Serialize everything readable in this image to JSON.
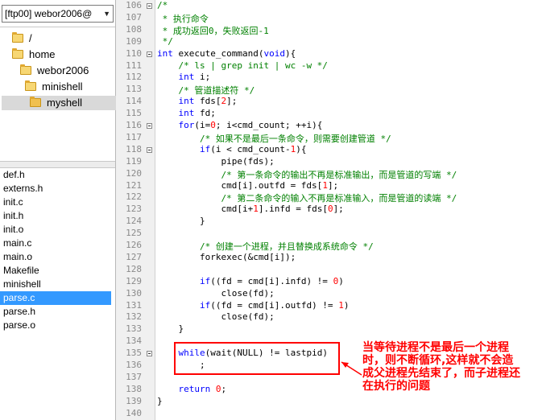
{
  "ftp_selector": {
    "value": "[ftp00] webor2006@"
  },
  "tree": [
    {
      "label": "/"
    },
    {
      "label": "home"
    },
    {
      "label": "webor2006"
    },
    {
      "label": "minishell"
    },
    {
      "label": "myshell",
      "selected": true
    }
  ],
  "files": [
    {
      "name": "def.h"
    },
    {
      "name": "externs.h"
    },
    {
      "name": "init.c"
    },
    {
      "name": "init.h"
    },
    {
      "name": "init.o"
    },
    {
      "name": "main.c"
    },
    {
      "name": "main.o"
    },
    {
      "name": "Makefile"
    },
    {
      "name": "minishell"
    },
    {
      "name": "parse.c",
      "selected": true
    },
    {
      "name": "parse.h"
    },
    {
      "name": "parse.o"
    }
  ],
  "code_lines": [
    {
      "n": "106",
      "fold": true,
      "segs": [
        [
          "c",
          "/*"
        ]
      ]
    },
    {
      "n": "107",
      "segs": [
        [
          "c",
          " * 执行命令"
        ]
      ]
    },
    {
      "n": "108",
      "segs": [
        [
          "c",
          " * 成功返回0，失败返回-1"
        ]
      ]
    },
    {
      "n": "109",
      "segs": [
        [
          "c",
          " */"
        ]
      ]
    },
    {
      "n": "110",
      "fold": true,
      "segs": [
        [
          "k",
          "int"
        ],
        [
          "p",
          " execute_command("
        ],
        [
          "k",
          "void"
        ],
        [
          "p",
          "){"
        ]
      ]
    },
    {
      "n": "111",
      "segs": [
        [
          "p",
          "    "
        ],
        [
          "c",
          "/* ls | grep init | wc -w */"
        ]
      ]
    },
    {
      "n": "112",
      "segs": [
        [
          "p",
          "    "
        ],
        [
          "k",
          "int"
        ],
        [
          "p",
          " i;"
        ]
      ]
    },
    {
      "n": "113",
      "segs": [
        [
          "p",
          "    "
        ],
        [
          "c",
          "/* 管道描述符 */"
        ]
      ]
    },
    {
      "n": "114",
      "segs": [
        [
          "p",
          "    "
        ],
        [
          "k",
          "int"
        ],
        [
          "p",
          " fds["
        ],
        [
          "n",
          "2"
        ],
        [
          "p",
          "];"
        ]
      ]
    },
    {
      "n": "115",
      "segs": [
        [
          "p",
          "    "
        ],
        [
          "k",
          "int"
        ],
        [
          "p",
          " fd;"
        ]
      ]
    },
    {
      "n": "116",
      "fold": true,
      "segs": [
        [
          "p",
          "    "
        ],
        [
          "k",
          "for"
        ],
        [
          "p",
          "(i="
        ],
        [
          "n",
          "0"
        ],
        [
          "p",
          "; i<cmd_count; ++i){"
        ]
      ]
    },
    {
      "n": "117",
      "segs": [
        [
          "p",
          "        "
        ],
        [
          "c",
          "/* 如果不是最后一条命令，则需要创建管道 */"
        ]
      ]
    },
    {
      "n": "118",
      "fold": true,
      "segs": [
        [
          "p",
          "        "
        ],
        [
          "k",
          "if"
        ],
        [
          "p",
          "(i < cmd_count-"
        ],
        [
          "n",
          "1"
        ],
        [
          "p",
          "){"
        ]
      ]
    },
    {
      "n": "119",
      "segs": [
        [
          "p",
          "            pipe(fds);"
        ]
      ]
    },
    {
      "n": "120",
      "segs": [
        [
          "p",
          "            "
        ],
        [
          "c",
          "/* 第一条命令的输出不再是标准输出，而是管道的写端 */"
        ]
      ]
    },
    {
      "n": "121",
      "segs": [
        [
          "p",
          "            cmd[i].outfd = fds["
        ],
        [
          "n",
          "1"
        ],
        [
          "p",
          "];"
        ]
      ]
    },
    {
      "n": "122",
      "segs": [
        [
          "p",
          "            "
        ],
        [
          "c",
          "/* 第二条命令的输入不再是标准输入，而是管道的读端 */"
        ]
      ]
    },
    {
      "n": "123",
      "segs": [
        [
          "p",
          "            cmd[i+"
        ],
        [
          "n",
          "1"
        ],
        [
          "p",
          "].infd = fds["
        ],
        [
          "n",
          "0"
        ],
        [
          "p",
          "];"
        ]
      ]
    },
    {
      "n": "124",
      "segs": [
        [
          "p",
          "        }"
        ]
      ]
    },
    {
      "n": "125",
      "segs": [
        [
          "p",
          ""
        ]
      ]
    },
    {
      "n": "126",
      "segs": [
        [
          "p",
          "        "
        ],
        [
          "c",
          "/* 创建一个进程，并且替换成系统命令 */"
        ]
      ]
    },
    {
      "n": "127",
      "segs": [
        [
          "p",
          "        forkexec(&cmd[i]);"
        ]
      ]
    },
    {
      "n": "128",
      "segs": [
        [
          "p",
          ""
        ]
      ]
    },
    {
      "n": "129",
      "segs": [
        [
          "p",
          "        "
        ],
        [
          "k",
          "if"
        ],
        [
          "p",
          "((fd = cmd[i].infd) != "
        ],
        [
          "n",
          "0"
        ],
        [
          "p",
          ")"
        ]
      ]
    },
    {
      "n": "130",
      "segs": [
        [
          "p",
          "            close(fd);"
        ]
      ]
    },
    {
      "n": "131",
      "segs": [
        [
          "p",
          "        "
        ],
        [
          "k",
          "if"
        ],
        [
          "p",
          "((fd = cmd[i].outfd) != "
        ],
        [
          "n",
          "1"
        ],
        [
          "p",
          ")"
        ]
      ]
    },
    {
      "n": "132",
      "segs": [
        [
          "p",
          "            close(fd);"
        ]
      ]
    },
    {
      "n": "133",
      "segs": [
        [
          "p",
          "    }"
        ]
      ]
    },
    {
      "n": "134",
      "segs": [
        [
          "p",
          ""
        ]
      ]
    },
    {
      "n": "135",
      "fold": true,
      "segs": [
        [
          "p",
          "    "
        ],
        [
          "k",
          "while"
        ],
        [
          "p",
          "(wait(NULL) != lastpid)"
        ]
      ]
    },
    {
      "n": "136",
      "segs": [
        [
          "p",
          "        ;"
        ]
      ]
    },
    {
      "n": "137",
      "segs": [
        [
          "p",
          ""
        ]
      ]
    },
    {
      "n": "138",
      "segs": [
        [
          "p",
          "    "
        ],
        [
          "k",
          "return"
        ],
        [
          "p",
          " "
        ],
        [
          "n",
          "0"
        ],
        [
          "p",
          ";"
        ]
      ]
    },
    {
      "n": "139",
      "segs": [
        [
          "p",
          "}"
        ]
      ]
    },
    {
      "n": "140",
      "segs": [
        [
          "p",
          ""
        ]
      ]
    }
  ],
  "annotation": {
    "text": "当等待进程不是最后一个进程时，则不断循环,这样就不会造成父进程先结束了，而子进程还在执行的问题",
    "color": "#ff0000"
  }
}
